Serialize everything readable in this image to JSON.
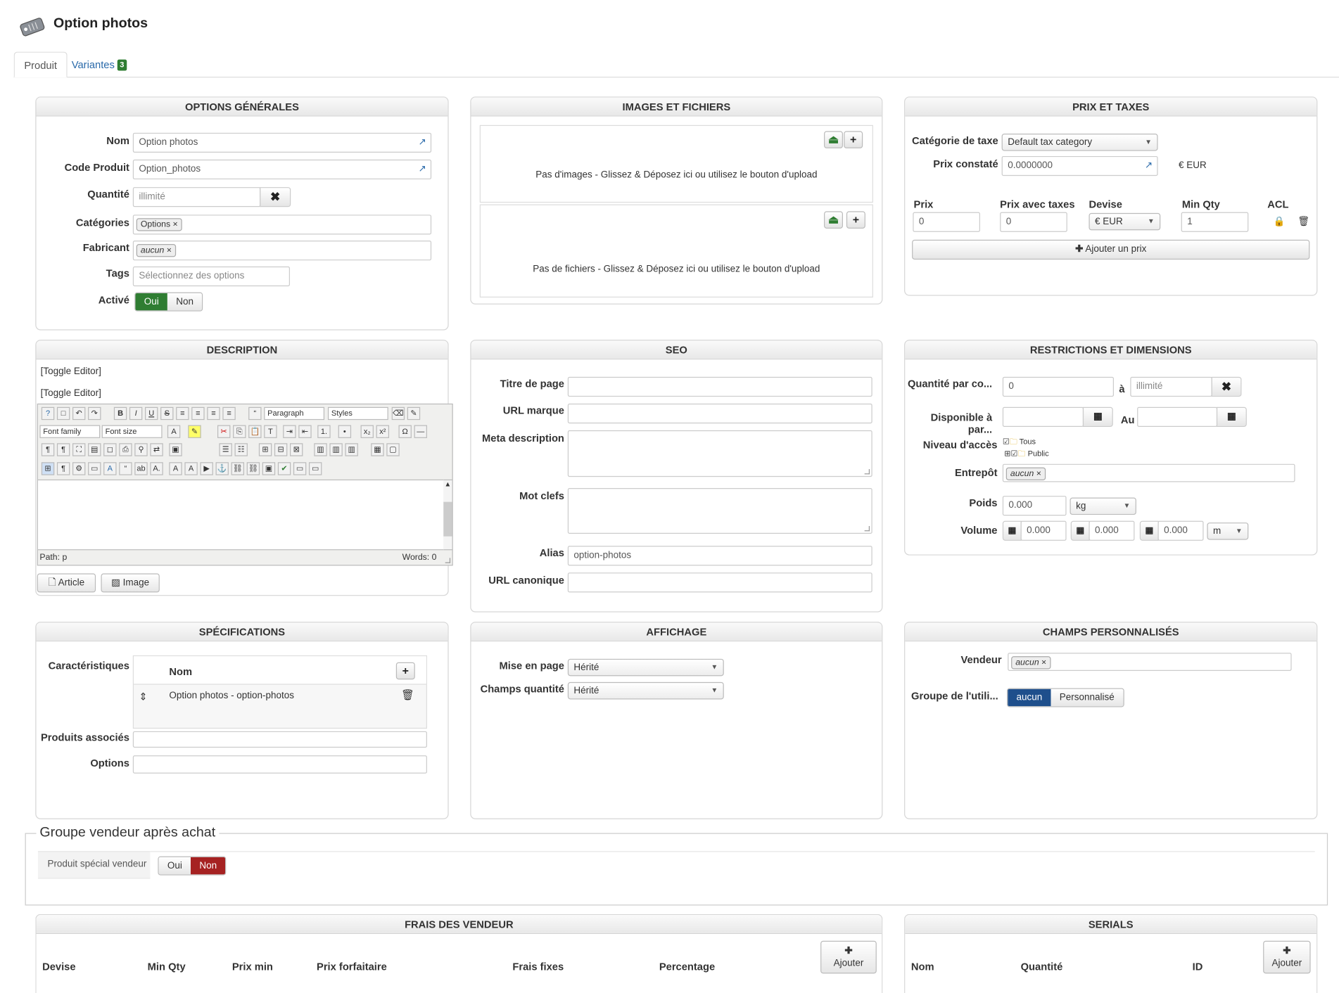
{
  "page": {
    "title": "Option photos"
  },
  "tabs": [
    {
      "label": "Produit"
    },
    {
      "label": "Variantes",
      "badge": "3"
    }
  ],
  "general": {
    "header": "OPTIONS GÉNÉRALES",
    "name_label": "Nom",
    "name_value": "Option photos",
    "code_label": "Code Produit",
    "code_value": "Option_photos",
    "qty_label": "Quantité",
    "qty_placeholder": "illimité",
    "cat_label": "Catégories",
    "cat_chip": "Options",
    "brand_label": "Fabricant",
    "brand_chip": "aucun",
    "tags_label": "Tags",
    "tags_placeholder": "Sélectionnez des options",
    "active_label": "Activé",
    "yes": "Oui",
    "no": "Non"
  },
  "images": {
    "header": "IMAGES ET FICHIERS",
    "no_images": "Pas d'images - Glissez & Déposez ici ou utilisez le bouton d'upload",
    "no_files": "Pas de fichiers - Glissez & Déposez ici ou utilisez le bouton d'upload"
  },
  "price": {
    "header": "PRIX ET TAXES",
    "taxcat_label": "Catégorie de taxe",
    "taxcat_value": "Default tax category",
    "observed_label": "Prix constaté",
    "observed_value": "0.0000000",
    "observed_currency": "€ EUR",
    "cols": {
      "price": "Prix",
      "price_tax": "Prix avec taxes",
      "currency": "Devise",
      "min_qty": "Min Qty",
      "acl": "ACL"
    },
    "row": {
      "price": "0",
      "price_tax": "0",
      "currency": "€ EUR",
      "min_qty": "1"
    },
    "add_price": "Ajouter un prix"
  },
  "description": {
    "header": "DESCRIPTION",
    "toggle1": "[Toggle Editor]",
    "toggle2": "[Toggle Editor]",
    "format": "Paragraph",
    "styles": "Styles",
    "font_family": "Font family",
    "font_size": "Font size",
    "path": "Path:  p",
    "words": "Words: 0",
    "article_btn": "Article",
    "image_btn": "Image"
  },
  "seo": {
    "header": "SEO",
    "title_label": "Titre de page",
    "url_label": "URL marque",
    "meta_label": "Meta description",
    "keywords_label": "Mot clefs",
    "alias_label": "Alias",
    "alias_value": "option-photos",
    "canonical_label": "URL canonique"
  },
  "restrictions": {
    "header": "RESTRICTIONS ET DIMENSIONS",
    "qty_label": "Quantité par co...",
    "qty_from": "0",
    "to_label": "à",
    "qty_to_placeholder": "illimité",
    "avail_label": "Disponible à par...",
    "au_label": "Au",
    "access_label": "Niveau d'accès",
    "access_all": "Tous",
    "access_public": "Public",
    "warehouse_label": "Entrepôt",
    "warehouse_chip": "aucun",
    "weight_label": "Poids",
    "weight_value": "0.000",
    "weight_unit": "kg",
    "volume_label": "Volume",
    "vol1": "0.000",
    "vol2": "0.000",
    "vol3": "0.000",
    "vol_unit": "m"
  },
  "specs": {
    "header": "SPÉCIFICATIONS",
    "features_label": "Caractéristiques",
    "col_name": "Nom",
    "row_name": "Option photos - option-photos",
    "related_label": "Produits associés",
    "options_label": "Options"
  },
  "display": {
    "header": "AFFICHAGE",
    "layout_label": "Mise en page",
    "layout_value": "Hérité",
    "qtyfield_label": "Champs quantité",
    "qtyfield_value": "Hérité"
  },
  "custom": {
    "header": "CHAMPS PERSONNALISÉS",
    "vendor_label": "Vendeur",
    "vendor_chip": "aucun",
    "group_label": "Groupe de l'utili...",
    "group_none": "aucun",
    "group_custom": "Personnalisé"
  },
  "vendor_group": {
    "legend": "Groupe vendeur après achat",
    "special_label": "Produit spécial vendeur",
    "yes": "Oui",
    "no": "Non"
  },
  "vendor_fees": {
    "header": "FRAIS DES VENDEUR",
    "cols": [
      "Devise",
      "Min Qty",
      "Prix min",
      "Prix forfaitaire",
      "Frais fixes",
      "Percentage"
    ],
    "add": "Ajouter"
  },
  "serials": {
    "header": "SERIALS",
    "cols": [
      "Nom",
      "Quantité",
      "ID"
    ],
    "add": "Ajouter"
  }
}
